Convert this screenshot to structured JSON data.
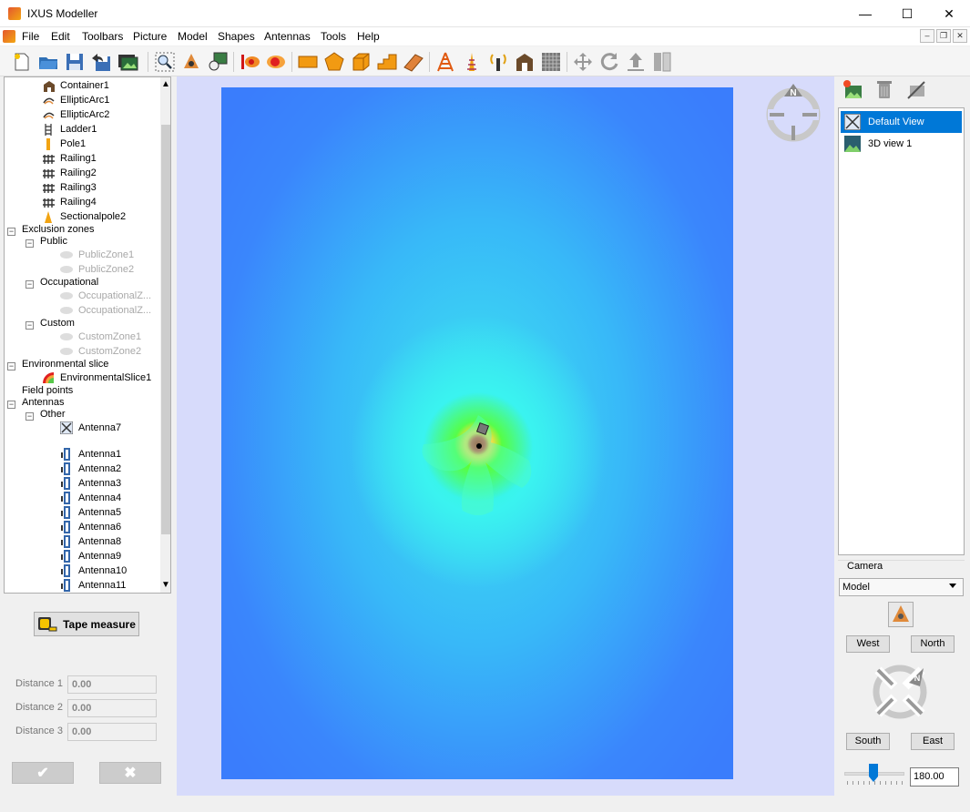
{
  "window": {
    "title": "IXUS Modeller",
    "minimize": "—",
    "maximize": "☐",
    "close": "✕"
  },
  "menu": [
    "File",
    "Edit",
    "Toolbars",
    "Picture",
    "Model",
    "Shapes",
    "Antennas",
    "Tools",
    "Help"
  ],
  "mdi": {
    "minimize": "–",
    "restore": "❐",
    "close": "✕"
  },
  "tree": {
    "items": [
      {
        "label": "Container1",
        "icon": "container-icon"
      },
      {
        "label": "EllipticArc1",
        "icon": "arc-icon"
      },
      {
        "label": "EllipticArc2",
        "icon": "arc-icon"
      },
      {
        "label": "Ladder1",
        "icon": "ladder-icon"
      },
      {
        "label": "Pole1",
        "icon": "pole-icon"
      },
      {
        "label": "Railing1",
        "icon": "railing-icon"
      },
      {
        "label": "Railing2",
        "icon": "railing-icon"
      },
      {
        "label": "Railing3",
        "icon": "railing-icon"
      },
      {
        "label": "Railing4",
        "icon": "railing-icon"
      },
      {
        "label": "Sectionalpole2",
        "icon": "sectional-pole-icon"
      }
    ],
    "exclusion_zones": "Exclusion zones",
    "public": "Public",
    "public_zones": [
      "PublicZone1",
      "PublicZone2"
    ],
    "occupational": "Occupational",
    "occupational_zones": [
      "OccupationalZ...",
      "OccupationalZ..."
    ],
    "custom": "Custom",
    "custom_zones": [
      "CustomZone1",
      "CustomZone2"
    ],
    "environmental_slice": "Environmental slice",
    "environmental_slice_item": "EnvironmentalSlice1",
    "field_points": "Field points",
    "antennas": "Antennas",
    "other": "Other",
    "antenna7": "Antenna7",
    "antenna_list": [
      "Antenna1",
      "Antenna2",
      "Antenna3",
      "Antenna4",
      "Antenna5",
      "Antenna6",
      "Antenna8",
      "Antenna9",
      "Antenna10",
      "Antenna11"
    ]
  },
  "tape_measure": {
    "label": "Tape measure"
  },
  "distances": [
    {
      "label": "Distance 1",
      "value": "0.00"
    },
    {
      "label": "Distance 2",
      "value": "0.00"
    },
    {
      "label": "Distance 3",
      "value": "0.00"
    }
  ],
  "confirm": {
    "ok": "✔",
    "cancel": "✖"
  },
  "compass": {
    "n": "N"
  },
  "views": [
    {
      "label": "Default View",
      "selected": true
    },
    {
      "label": "3D view 1",
      "selected": false
    }
  ],
  "camera": {
    "label": "Camera",
    "mode": "Model",
    "west": "West",
    "north": "North",
    "south": "South",
    "east": "East",
    "angle": "180.00",
    "compass_n": "N"
  },
  "colors": {
    "selection": "#0078d7",
    "viewport_bg": "#d7dbfb"
  }
}
